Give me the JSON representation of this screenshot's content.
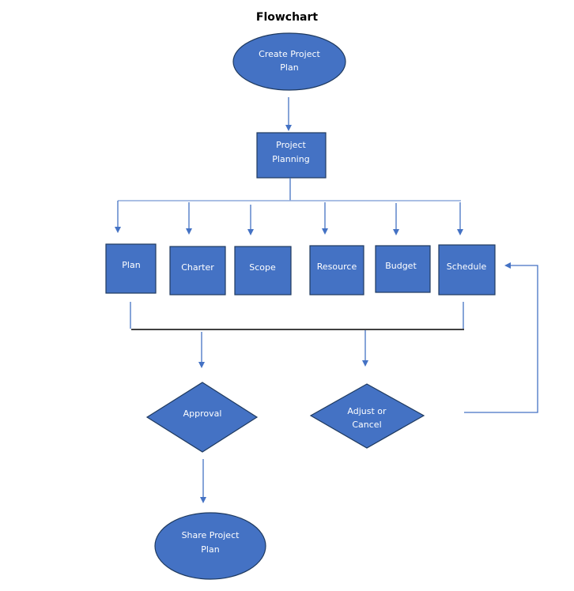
{
  "title": "Flowchart",
  "colors": {
    "shape_fill": "#4472c4",
    "shape_border": "#1f3a5f",
    "connector": "#4472c4",
    "merge_line": "#000000",
    "text": "#ffffff"
  },
  "nodes": {
    "start": {
      "type": "terminator",
      "lines": [
        "Create Project",
        "Plan"
      ]
    },
    "planning": {
      "type": "process",
      "lines": [
        "Project",
        "Planning"
      ]
    },
    "plan": {
      "type": "process",
      "lines": [
        "Plan"
      ]
    },
    "charter": {
      "type": "process",
      "lines": [
        "Charter"
      ]
    },
    "scope": {
      "type": "process",
      "lines": [
        "Scope"
      ]
    },
    "resource": {
      "type": "process",
      "lines": [
        "Resource"
      ]
    },
    "budget": {
      "type": "process",
      "lines": [
        "Budget"
      ]
    },
    "schedule": {
      "type": "process",
      "lines": [
        "Schedule"
      ]
    },
    "approval": {
      "type": "decision",
      "lines": [
        "Approval"
      ]
    },
    "adjust": {
      "type": "decision",
      "lines": [
        "Adjust or",
        "Cancel"
      ]
    },
    "share": {
      "type": "terminator",
      "lines": [
        "Share Project",
        "Plan"
      ]
    }
  },
  "edges": [
    {
      "from": "start",
      "to": "planning"
    },
    {
      "from": "planning",
      "to": "plan"
    },
    {
      "from": "planning",
      "to": "charter"
    },
    {
      "from": "planning",
      "to": "scope"
    },
    {
      "from": "planning",
      "to": "resource"
    },
    {
      "from": "planning",
      "to": "budget"
    },
    {
      "from": "planning",
      "to": "schedule"
    },
    {
      "from": "plan-to-schedule-merge",
      "to": "approval"
    },
    {
      "from": "plan-to-schedule-merge",
      "to": "adjust"
    },
    {
      "from": "approval",
      "to": "share"
    },
    {
      "from": "adjust",
      "to": "schedule"
    }
  ]
}
